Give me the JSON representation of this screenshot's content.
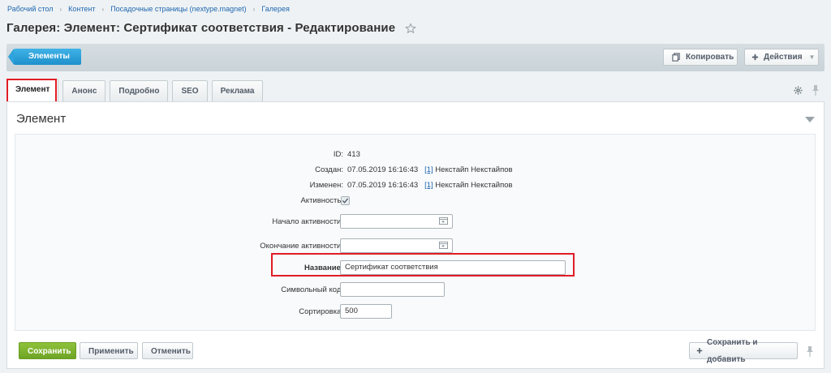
{
  "breadcrumb": [
    "Рабочий стол",
    "Контент",
    "Посадочные страницы (nextype.magnet)",
    "Галерея"
  ],
  "page_title": "Галерея: Элемент: Сертификат соответствия - Редактирование",
  "toolbar": {
    "elements_label": "Элементы",
    "copy_label": "Копировать",
    "actions_label": "Действия"
  },
  "tabs": [
    {
      "label": "Элемент",
      "active": true
    },
    {
      "label": "Анонс",
      "active": false
    },
    {
      "label": "Подробно",
      "active": false
    },
    {
      "label": "SEO",
      "active": false
    },
    {
      "label": "Реклама",
      "active": false
    }
  ],
  "section": {
    "title": "Элемент",
    "fields": {
      "id_label": "ID:",
      "id_value": "413",
      "created_label": "Создан:",
      "created_date": "07.05.2019 16:16:43",
      "created_user_id": "[1]",
      "created_user_name": "Некстайп Некстайпов",
      "modified_label": "Изменен:",
      "modified_date": "07.05.2019 16:16:43",
      "modified_user_id": "[1]",
      "modified_user_name": "Некстайп Некстайпов",
      "active_label": "Активность:",
      "active_checked": true,
      "active_from_label": "Начало активности:",
      "active_from_value": "",
      "active_to_label": "Окончание активности:",
      "active_to_value": "",
      "name_label": "Название:",
      "name_value": "Сертификат соответствия",
      "code_label": "Символьный код:",
      "code_value": "",
      "sort_label": "Сортировка:",
      "sort_value": "500"
    }
  },
  "buttons": {
    "save": "Сохранить",
    "apply": "Применить",
    "cancel": "Отменить",
    "save_and_add": "Сохранить и добавить"
  },
  "colors": {
    "accent_blue": "#1e90cc",
    "save_green": "#6ea426",
    "highlight_red": "#e11d26",
    "link": "#2067b0"
  }
}
